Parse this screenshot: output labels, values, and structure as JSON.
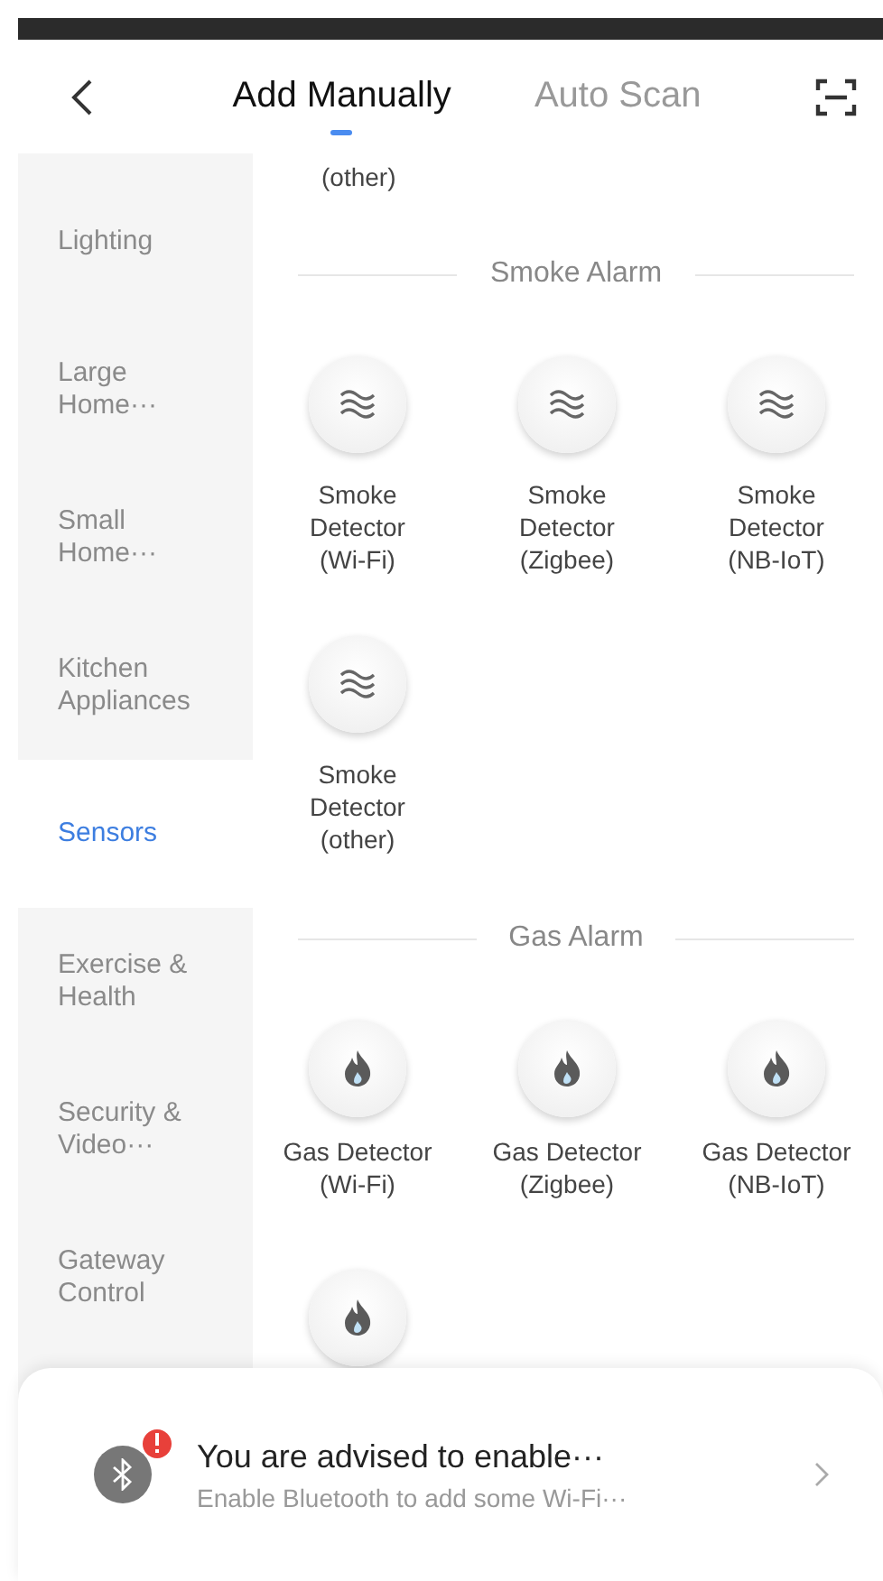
{
  "header": {
    "tabs": [
      {
        "label": "Add Manually",
        "selected": true
      },
      {
        "label": "Auto Scan",
        "selected": false
      }
    ]
  },
  "sidebar": {
    "items": [
      {
        "label": "Lighting",
        "selected": false
      },
      {
        "label": "Large Home···",
        "selected": false
      },
      {
        "label": "Small Home···",
        "selected": false
      },
      {
        "label": "Kitchen Appliances",
        "selected": false
      },
      {
        "label": "Sensors",
        "selected": true
      },
      {
        "label": "Exercise & Health",
        "selected": false
      },
      {
        "label": "Security & Video···",
        "selected": false
      },
      {
        "label": "Gateway Control",
        "selected": false
      }
    ]
  },
  "content": {
    "partial_label": "(other)",
    "sections": [
      {
        "title": "Smoke Alarm",
        "kind": "smoke",
        "devices": [
          {
            "name": "Smoke Detector (Wi-Fi)"
          },
          {
            "name": "Smoke Detector (Zigbee)"
          },
          {
            "name": "Smoke Detector (NB-IoT)"
          },
          {
            "name": "Smoke Detector (other)"
          }
        ]
      },
      {
        "title": "Gas Alarm",
        "kind": "gas",
        "devices": [
          {
            "name": "Gas Detector (Wi-Fi)"
          },
          {
            "name": "Gas Detector (Zigbee)"
          },
          {
            "name": "Gas Detector (NB-IoT)"
          }
        ],
        "more_below": true
      }
    ]
  },
  "notice": {
    "title": "You are advised to enable···",
    "subtitle": "Enable Bluetooth to add some Wi-Fi···"
  }
}
